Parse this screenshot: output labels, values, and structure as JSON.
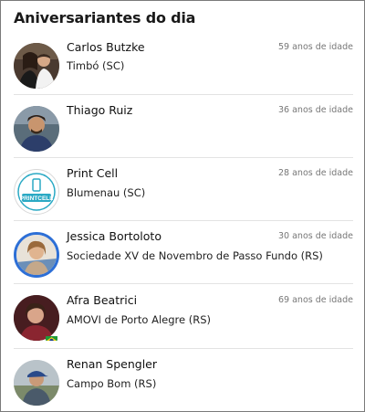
{
  "widget": {
    "title": "Aniversariantes do dia",
    "people": [
      {
        "name": "Carlos Butzke",
        "city": "Timbó (SC)",
        "age": "59 anos de idade",
        "avatar": "couple-photo-avatar"
      },
      {
        "name": "Thiago Ruiz",
        "city": "",
        "age": "36 anos de idade",
        "avatar": "man-photo-avatar"
      },
      {
        "name": "Print Cell",
        "city": "Blumenau (SC)",
        "age": "28 anos de idade",
        "avatar": "printcell-logo-avatar",
        "logo_text": "PRINTCELL"
      },
      {
        "name": "Jessica Bortoloto",
        "city": "Sociedade XV de Novembro  de Passo Fundo (RS)",
        "age": "30 anos de idade",
        "avatar": "woman-photo-avatar"
      },
      {
        "name": "Afra Beatrici",
        "city": "AMOVI de Porto Alegre (RS)",
        "age": "69 anos de idade",
        "avatar": "woman-red-photo-avatar",
        "badge": "brazil-flag-icon"
      },
      {
        "name": "Renan Spengler",
        "city": "Campo Bom (RS)",
        "age": "",
        "avatar": "man-cap-photo-avatar"
      }
    ]
  },
  "colors": {
    "separator": "#e3e3e3",
    "age_text": "#777777",
    "border": "#7a7a7a",
    "highlight_ring": "#2d6fd6",
    "logo_teal": "#2aa9c4"
  }
}
